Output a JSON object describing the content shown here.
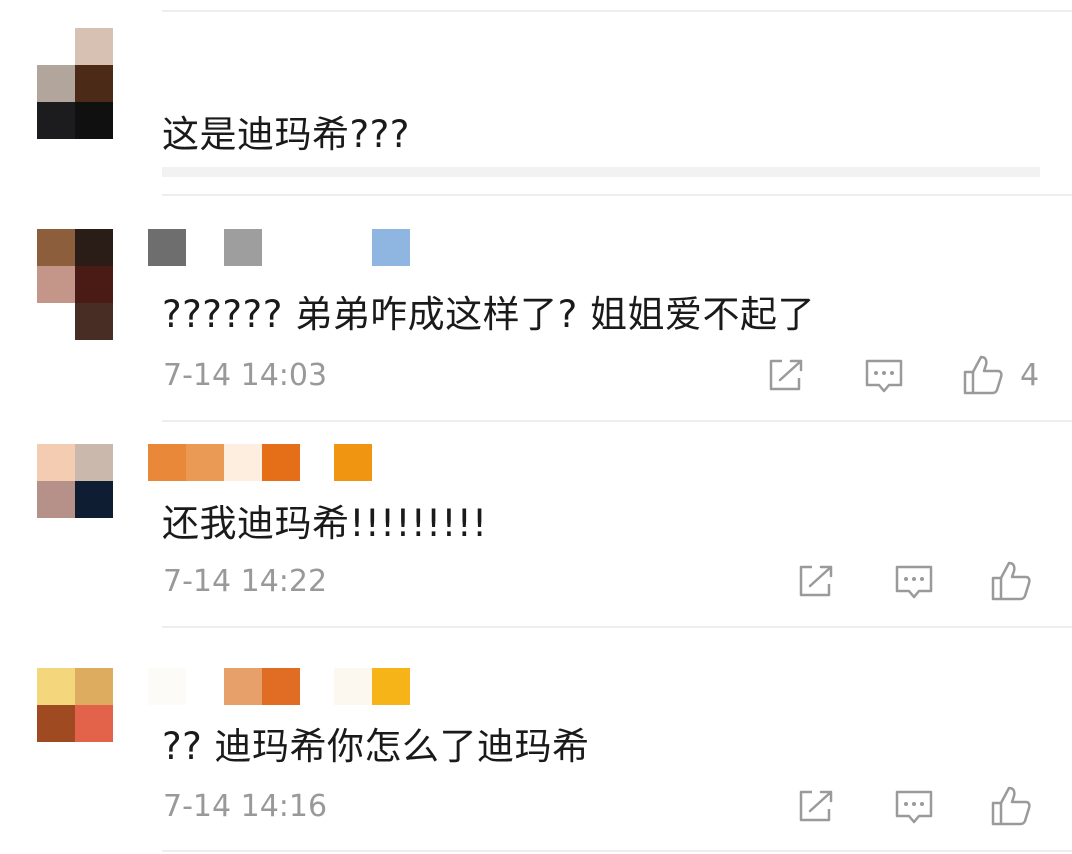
{
  "comments": [
    {
      "text": "这是迪玛希???"
    },
    {
      "text": "?????? 弟弟咋成这样了? 姐姐爱不起了",
      "time": "7-14 14:03",
      "likes": "4"
    },
    {
      "text": "还我迪玛希!!!!!!!!!",
      "time": "7-14 14:22"
    },
    {
      "text": "?? 迪玛希你怎么了迪玛希",
      "time": "7-14 14:16"
    }
  ],
  "icons": {
    "share": "share-icon",
    "comment": "comment-icon",
    "like": "thumbs-up-icon"
  },
  "colors": {
    "text": "#1a1a1a",
    "meta": "#999999",
    "icon": "#9a9a9a",
    "divider": "#eeeeee"
  }
}
